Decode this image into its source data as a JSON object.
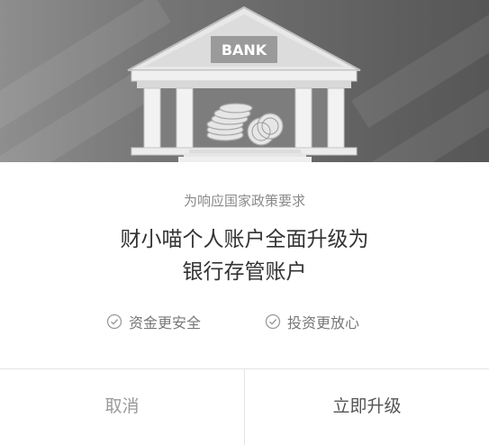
{
  "hero": {
    "bank_sign": "BANK"
  },
  "dialog": {
    "subtitle": "为响应国家政策要求",
    "title_line1": "财小喵个人账户全面升级为",
    "title_line2": "银行存管账户",
    "features": [
      {
        "label": "资金更安全",
        "icon": "check-circle-icon"
      },
      {
        "label": "投资更放心",
        "icon": "check-circle-icon"
      }
    ]
  },
  "buttons": {
    "cancel_label": "取消",
    "upgrade_label": "立即升级"
  }
}
